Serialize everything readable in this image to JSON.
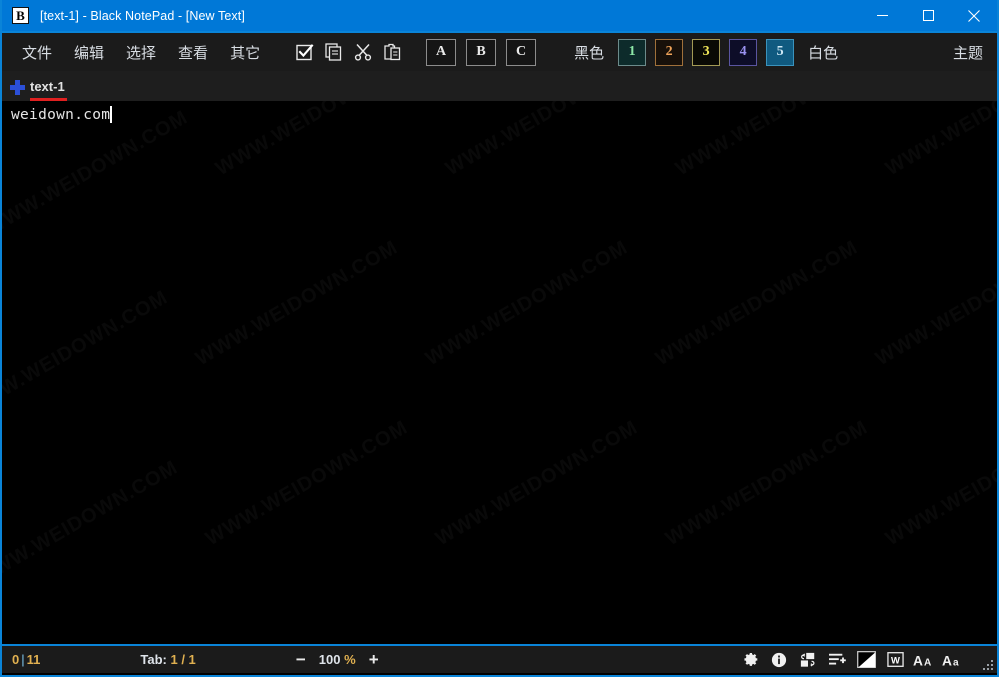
{
  "window": {
    "logo_letter": "B",
    "title": "[text-1] - Black NotePad - [New Text]",
    "minimize_label": "minimize",
    "maximize_label": "maximize",
    "close_label": "close",
    "accent_color": "#0078d7",
    "border_color": "#0a84d8"
  },
  "menu": {
    "items": [
      {
        "label": "文件"
      },
      {
        "label": "编辑"
      },
      {
        "label": "选择"
      },
      {
        "label": "查看"
      },
      {
        "label": "其它"
      }
    ]
  },
  "toolbar": {
    "icons": [
      {
        "name": "select-all-checkbox-icon",
        "label": "全选"
      },
      {
        "name": "copy-icon",
        "label": "复制"
      },
      {
        "name": "cut-icon",
        "label": "剪切"
      },
      {
        "name": "paste-icon",
        "label": "粘贴"
      }
    ],
    "font_buttons": [
      {
        "label": "A"
      },
      {
        "label": "B"
      },
      {
        "label": "C"
      }
    ],
    "black_label": "黑色",
    "white_label": "白色",
    "theme_label": "主题",
    "swatches": [
      {
        "label": "1",
        "bg": "#0d2b2b",
        "fg": "#8de8a8",
        "border": "#6c8b8b",
        "selected": false
      },
      {
        "label": "2",
        "bg": "#17100a",
        "fg": "#f0a45a",
        "border": "#a0703a",
        "selected": false
      },
      {
        "label": "3",
        "bg": "#0a0a05",
        "fg": "#f2e85a",
        "border": "#a39a55",
        "selected": false
      },
      {
        "label": "4",
        "bg": "#0d0d28",
        "fg": "#9a92f0",
        "border": "#5a55a0",
        "selected": false
      },
      {
        "label": "5",
        "bg": "#105a80",
        "fg": "#cfe8f5",
        "border": "#3a93bd",
        "selected": true
      }
    ]
  },
  "tabs": {
    "new_tab_label": "新建",
    "items": [
      {
        "label": "text-1",
        "active": true,
        "underline_color": "#e02020"
      }
    ]
  },
  "editor": {
    "content": "weidown.com",
    "caret_visible": true,
    "background": "#000000",
    "foreground": "#e6e6e6"
  },
  "watermark": {
    "text": "WWW.WEIDOWN.COM"
  },
  "statusbar": {
    "position_left": "0",
    "position_sep": "|",
    "position_right": "11",
    "tab_label": "Tab:",
    "tab_value": "1 / 1",
    "zoom_out_label": "−",
    "zoom_value": "100",
    "zoom_unit": "%",
    "zoom_in_label": "+",
    "icons": [
      {
        "name": "settings-gear-icon",
        "label": "设置"
      },
      {
        "name": "info-icon",
        "label": "信息"
      },
      {
        "name": "convert-icon",
        "label": "转换"
      },
      {
        "name": "insert-line-icon",
        "label": "插入"
      },
      {
        "name": "contrast-icon",
        "label": "对比度"
      },
      {
        "name": "word-wrap-icon",
        "label": "自动换行"
      },
      {
        "name": "font-increase-icon",
        "label": "增大字体"
      },
      {
        "name": "font-decrease-icon",
        "label": "减小字体"
      }
    ]
  }
}
